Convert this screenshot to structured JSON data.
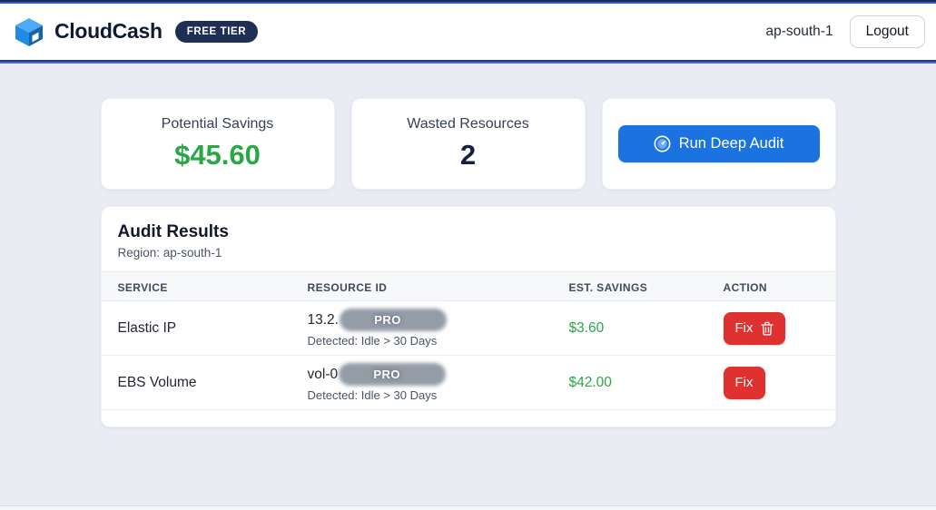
{
  "header": {
    "brand": "CloudCash",
    "tier_badge": "FREE TIER",
    "region": "ap-south-1",
    "logout_label": "Logout"
  },
  "stats": {
    "potential_savings": {
      "label": "Potential Savings",
      "value": "$45.60"
    },
    "wasted_resources": {
      "label": "Wasted Resources",
      "value": "2"
    },
    "audit_button": {
      "label": "Run Deep Audit"
    }
  },
  "audit": {
    "title": "Audit Results",
    "region_line": "Region: ap-south-1",
    "columns": [
      "SERVICE",
      "RESOURCE ID",
      "EST. SAVINGS",
      "ACTION"
    ],
    "rows": [
      {
        "service": "Elastic IP",
        "resource_prefix": "13.2.",
        "masked_badge": "PRO",
        "detected": "Detected: Idle > 30 Days",
        "savings": "$3.60",
        "action_label": "Fix"
      },
      {
        "service": "EBS Volume",
        "resource_prefix": "vol-0",
        "masked_badge": "PRO",
        "detected": "Detected: Idle > 30 Days",
        "savings": "$42.00",
        "action_label": "Fix"
      }
    ]
  },
  "colors": {
    "accent_blue": "#1b73e2",
    "navy_badge": "#1e2f55",
    "savings_green": "#28a745",
    "danger_red": "#e03131",
    "page_bg": "#e9edf3"
  }
}
